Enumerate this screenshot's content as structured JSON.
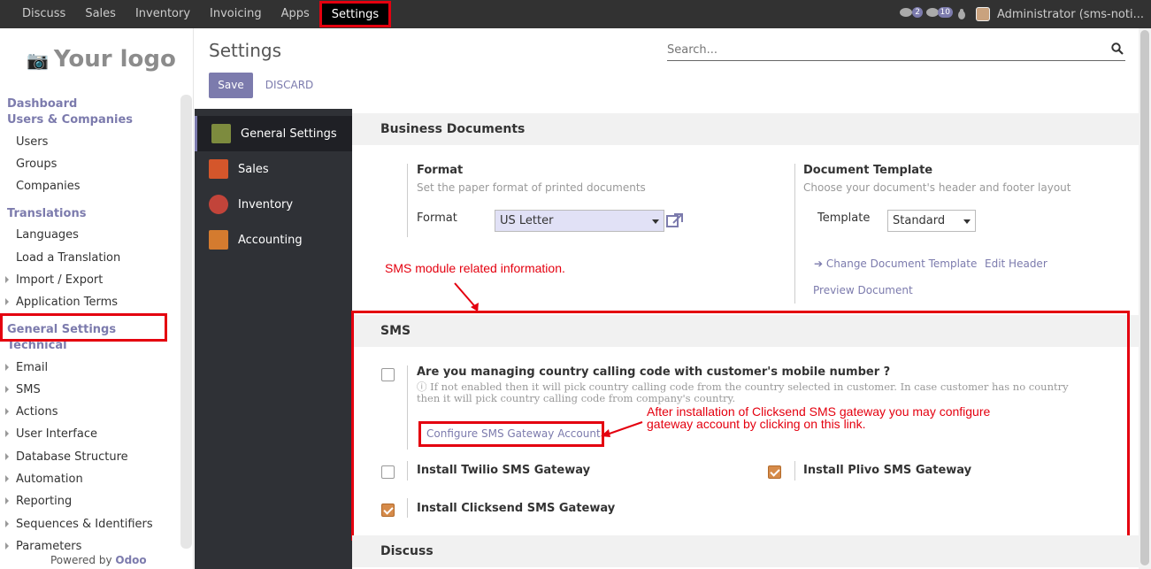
{
  "topbar": {
    "menu": [
      "Discuss",
      "Sales",
      "Inventory",
      "Invoicing",
      "Apps",
      "Settings"
    ],
    "active": "Settings",
    "chat_badge": "2",
    "msg_badge": "10",
    "user": "Administrator (sms-noti..."
  },
  "sidebar": {
    "logo": "Your logo",
    "dashboard": "Dashboard",
    "users_companies": "Users & Companies",
    "users": "Users",
    "groups": "Groups",
    "companies": "Companies",
    "translations": "Translations",
    "languages": "Languages",
    "load_translation": "Load a Translation",
    "import_export": "Import / Export",
    "app_terms": "Application Terms",
    "general_settings": "General Settings",
    "technical": "Technical",
    "email": "Email",
    "sms": "SMS",
    "actions": "Actions",
    "user_interface": "User Interface",
    "db_structure": "Database Structure",
    "automation": "Automation",
    "reporting": "Reporting",
    "sequences": "Sequences & Identifiers",
    "parameters": "Parameters",
    "powered_by": "Powered by",
    "odoo": "Odoo"
  },
  "control": {
    "title": "Settings",
    "save": "Save",
    "discard": "DISCARD",
    "search_placeholder": "Search..."
  },
  "setnav": [
    "General Settings",
    "Sales",
    "Inventory",
    "Accounting"
  ],
  "business_docs": {
    "title": "Business Documents",
    "format_label": "Format",
    "format_help": "Set the paper format of printed documents",
    "format_field": "Format",
    "format_value": "US Letter",
    "template_label": "Document Template",
    "template_help": "Choose your document's header and footer layout",
    "template_field": "Template",
    "template_value": "Standard",
    "change_template": "Change Document Template",
    "edit_header": "Edit Header",
    "preview": "Preview Document"
  },
  "sms": {
    "title": "SMS",
    "question": "Are you managing country calling code with customer's mobile number ?",
    "help_line1": "If not enabled then it will pick country calling code from the country selected in customer. In case customer has no country",
    "help_line2": "then it will pick country calling code from company's country.",
    "configure": "Configure SMS Gateway Account",
    "twilio": "Install Twilio SMS Gateway",
    "plivo": "Install Plivo SMS Gateway",
    "clicksend": "Install Clicksend SMS Gateway",
    "question_checked": false,
    "twilio_checked": false,
    "plivo_checked": true,
    "clicksend_checked": true
  },
  "discuss": {
    "title": "Discuss"
  },
  "annotations": {
    "sms_module": "SMS module related information.",
    "clicksend_line1": "After installation of Clicksend SMS gateway you may configure",
    "clicksend_line2": "gateway account by clicking on this link."
  },
  "colors": {
    "accent": "#7c7bad",
    "annotation_red": "#e4000f",
    "topbar": "#323232",
    "settings_nav": "#2f3136"
  }
}
